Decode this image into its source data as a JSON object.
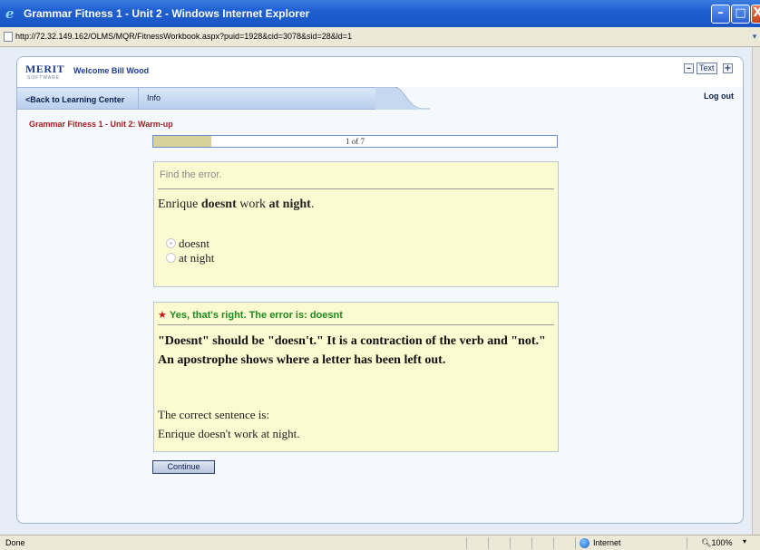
{
  "window": {
    "title": "Grammar Fitness 1 - Unit 2 - Windows Internet Explorer",
    "minimize_glyph": "–",
    "maximize_glyph": "□",
    "close_glyph": "X"
  },
  "address": {
    "url": "http://72.32.149.162/OLMS/MQR/FitnessWorkbook.aspx?puid=1928&cid=3078&sid=28&ld=1",
    "dropdown_glyph": "▾"
  },
  "header": {
    "logo_text": "MERIT",
    "logo_subtext": "SOFTWARE",
    "welcome": "Welcome Bill Wood",
    "text_size_label": "Text",
    "decrease_glyph": "–",
    "increase_glyph": "+"
  },
  "nav": {
    "back_label": "<Back to Learning Center",
    "info_label": "Info",
    "logout_label": "Log out"
  },
  "section_title": "Grammar Fitness 1 - Unit 2: Warm-up",
  "progress": {
    "label": "1 of 7",
    "current": 1,
    "total": 7
  },
  "question": {
    "instruction": "Find the error.",
    "sentence_parts": [
      "Enrique ",
      "doesnt",
      " work ",
      "at night",
      "."
    ],
    "options": [
      {
        "label": "doesnt",
        "selected": true
      },
      {
        "label": "at night",
        "selected": false
      }
    ]
  },
  "feedback": {
    "star_glyph": "★",
    "title": "Yes, that's right. The error is: doesnt",
    "explanation": "\"Doesnt\" should be \"doesn't.\" It is a contraction of the verb and \"not.\" An apostrophe shows where a letter has been left out.",
    "correct_label": "The correct sentence is:",
    "correct_sentence": "Enrique doesn't work at night."
  },
  "continue_label": "Continue",
  "status": {
    "text": "Done",
    "zone": "Internet",
    "zoom": "100%",
    "zoom_arrow": "▾"
  },
  "colors": {
    "title_bar": "#1f5fd0",
    "section_title": "#a31d1d",
    "feedback_title": "#1f8a1f",
    "box_background": "#fcfad0",
    "progress_fill": "#d7d19b"
  }
}
